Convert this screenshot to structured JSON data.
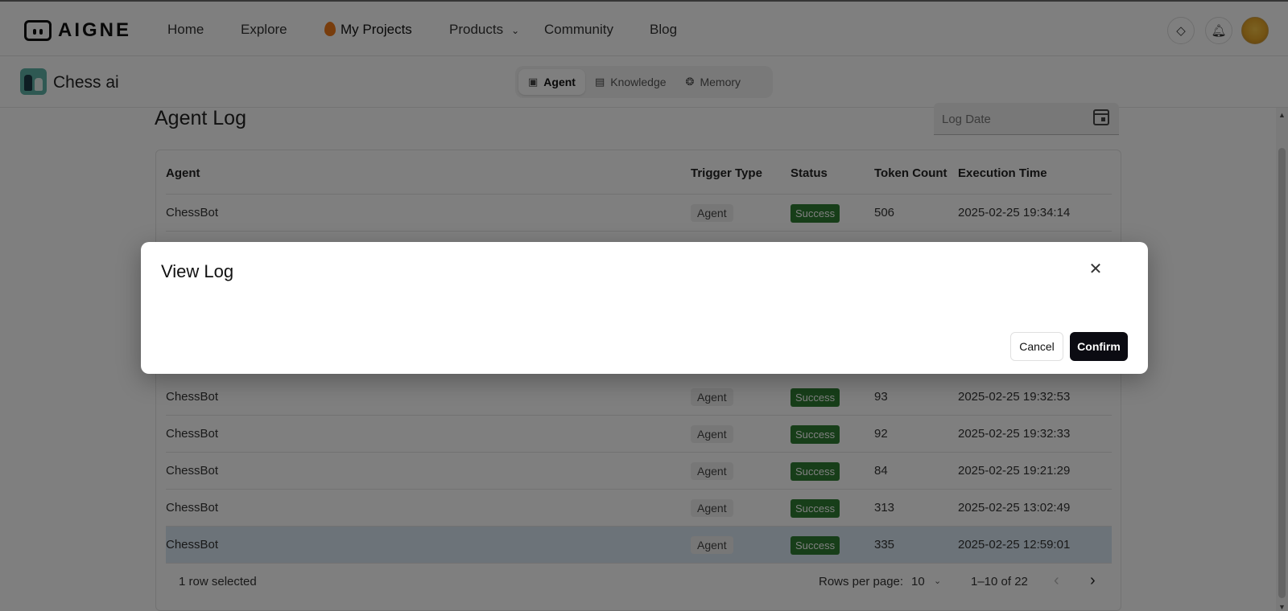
{
  "topnav": {
    "logo_text": "AIGNE",
    "links": [
      "Home",
      "Explore",
      "My Projects",
      "Products",
      "Community",
      "Blog"
    ]
  },
  "project": {
    "name": "Chess ai",
    "tabs": [
      "Agent",
      "Knowledge",
      "Memory"
    ],
    "active_tab": "Agent"
  },
  "main": {
    "title": "Agent Log",
    "date_placeholder": "Log Date"
  },
  "table": {
    "headers": [
      "Agent",
      "Trigger Type",
      "Status",
      "Token Count",
      "Execution Time"
    ],
    "rows": [
      {
        "agent": "ChessBot",
        "trigger": "Agent",
        "status": "Success",
        "tokens": "506",
        "time": "2025-02-25 19:34:14"
      },
      {
        "agent": "ChessBot",
        "trigger": "Agent",
        "status": "Success",
        "tokens": "93",
        "time": "2025-02-25 19:32:53"
      },
      {
        "agent": "ChessBot",
        "trigger": "Agent",
        "status": "Success",
        "tokens": "92",
        "time": "2025-02-25 19:32:33"
      },
      {
        "agent": "ChessBot",
        "trigger": "Agent",
        "status": "Success",
        "tokens": "84",
        "time": "2025-02-25 19:21:29"
      },
      {
        "agent": "ChessBot",
        "trigger": "Agent",
        "status": "Success",
        "tokens": "313",
        "time": "2025-02-25 13:02:49"
      },
      {
        "agent": "ChessBot",
        "trigger": "Agent",
        "status": "Success",
        "tokens": "335",
        "time": "2025-02-25 12:59:01"
      }
    ],
    "selected_row_index": 5,
    "footer": {
      "selected_text": "1 row selected",
      "rows_per_page_label": "Rows per page:",
      "rows_per_page_value": "10",
      "range": "1–10 of 22"
    }
  },
  "modal": {
    "title": "View Log",
    "cancel_label": "Cancel",
    "confirm_label": "Confirm"
  },
  "colors": {
    "success": "#2e7d32",
    "confirm_button": "#0b0b12",
    "selected_row": "#d8e6f2"
  }
}
